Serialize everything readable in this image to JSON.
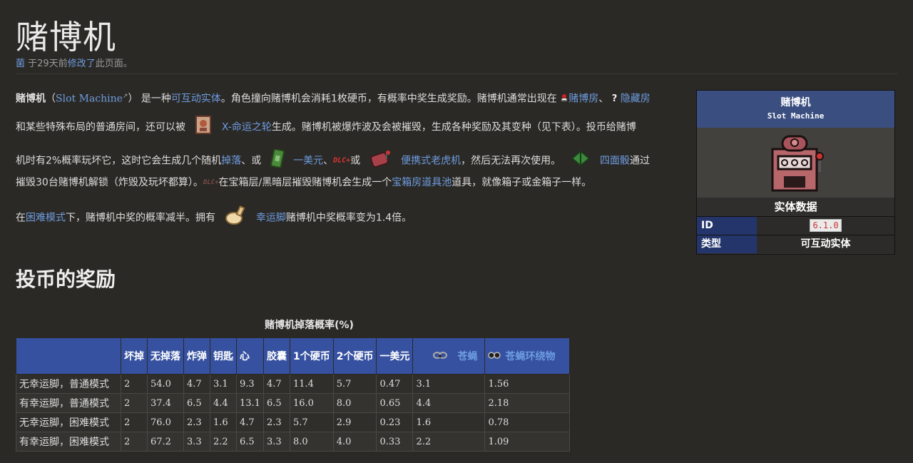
{
  "page": {
    "title": "赌博机",
    "meta": {
      "user": "菌",
      "time_prefix": "于29天前",
      "action": "修改了",
      "suffix": "此页面。"
    }
  },
  "intro": {
    "l1": {
      "term": "赌博机",
      "lp": "（",
      "en": "Slot Machine",
      "rp": "）",
      "t1": "是一种",
      "link1": "可互动实体",
      "t2": "。角色撞向赌博机会消耗1枚硬币，有概率中奖生成奖励。赌博机通常出现在",
      "link2": "赌博房",
      "sep": "、",
      "link3": "隐藏房"
    },
    "l2": {
      "t1": "和某些特殊布局的普通房间，还可以被",
      "link1": "X-命运之轮",
      "t2": "生成。赌博机被爆炸波及会被摧毁，生成各种奖励及其变种（见下表）。投币给赌博"
    },
    "l3": {
      "t1": "机时有2%概率玩坏它，这时它会生成几个随机",
      "link1": "掉落",
      "t2": "、或",
      "link2": "一美元",
      "t3": "、",
      "dlc": "DLC+",
      "t4": "或",
      "link3": "便携式老虎机",
      "t5": "，然后无法再次使用。",
      "link4": "四面骰",
      "t6": "通过"
    },
    "l4": {
      "t1": "摧毁30台赌博机解锁（炸毁及玩坏都算）。",
      "dlc": "DLC+",
      "t2": "在宝箱层/黑暗层摧毁赌博机会生成一个",
      "link1": "宝箱房道具池",
      "t3": "道具，就像箱子或金箱子一样。"
    },
    "l5": {
      "t1": "在",
      "link1": "困难模式",
      "t2": "下，赌博机中奖的概率减半。拥有",
      "link2": "幸运脚",
      "t3": "赌博机中奖概率变为1.4倍。"
    }
  },
  "section": {
    "heading": "投币的奖励"
  },
  "table": {
    "caption": "赌博机掉落概率(%)",
    "headers": [
      "",
      "坏掉",
      "无掉落",
      "炸弹",
      "钥匙",
      "心",
      "胶囊",
      "1个硬币",
      "2个硬币",
      "一美元",
      "苍蝇",
      "苍蝇环绕物"
    ],
    "rows": [
      [
        "无幸运脚，普通模式",
        "2",
        "54.0",
        "4.7",
        "3.1",
        "9.3",
        "4.7",
        "11.4",
        "5.7",
        "0.47",
        "3.1",
        "1.56"
      ],
      [
        "有幸运脚，普通模式",
        "2",
        "37.4",
        "6.5",
        "4.4",
        "13.1",
        "6.5",
        "16.0",
        "8.0",
        "0.65",
        "4.4",
        "2.18"
      ],
      [
        "无幸运脚，困难模式",
        "2",
        "76.0",
        "2.3",
        "1.6",
        "4.7",
        "2.3",
        "5.7",
        "2.9",
        "0.23",
        "1.6",
        "0.78"
      ],
      [
        "有幸运脚，困难模式",
        "2",
        "67.2",
        "3.3",
        "2.2",
        "6.5",
        "3.3",
        "8.0",
        "4.0",
        "0.33",
        "2.2",
        "1.09"
      ]
    ]
  },
  "infobox": {
    "title": "赌博机",
    "subtitle": "Slot Machine",
    "section": "实体数据",
    "rows": [
      {
        "key": "ID",
        "value": "6.1.0"
      },
      {
        "key": "类型",
        "value": "可互动实体"
      }
    ]
  },
  "colors": {
    "bg": "#2b2925",
    "link": "#6d9ce0",
    "header": "#3651a0",
    "infobox_head": "#3a4e80"
  },
  "icons": [
    "external-link-icon",
    "gamble-room-icon",
    "secret-room-icon",
    "wheel-of-fortune-card-icon",
    "dollar-icon",
    "portable-slot-icon",
    "d4-icon",
    "lucky-foot-icon",
    "fly-icon",
    "fly-orbital-icon",
    "slot-machine-sprite"
  ]
}
